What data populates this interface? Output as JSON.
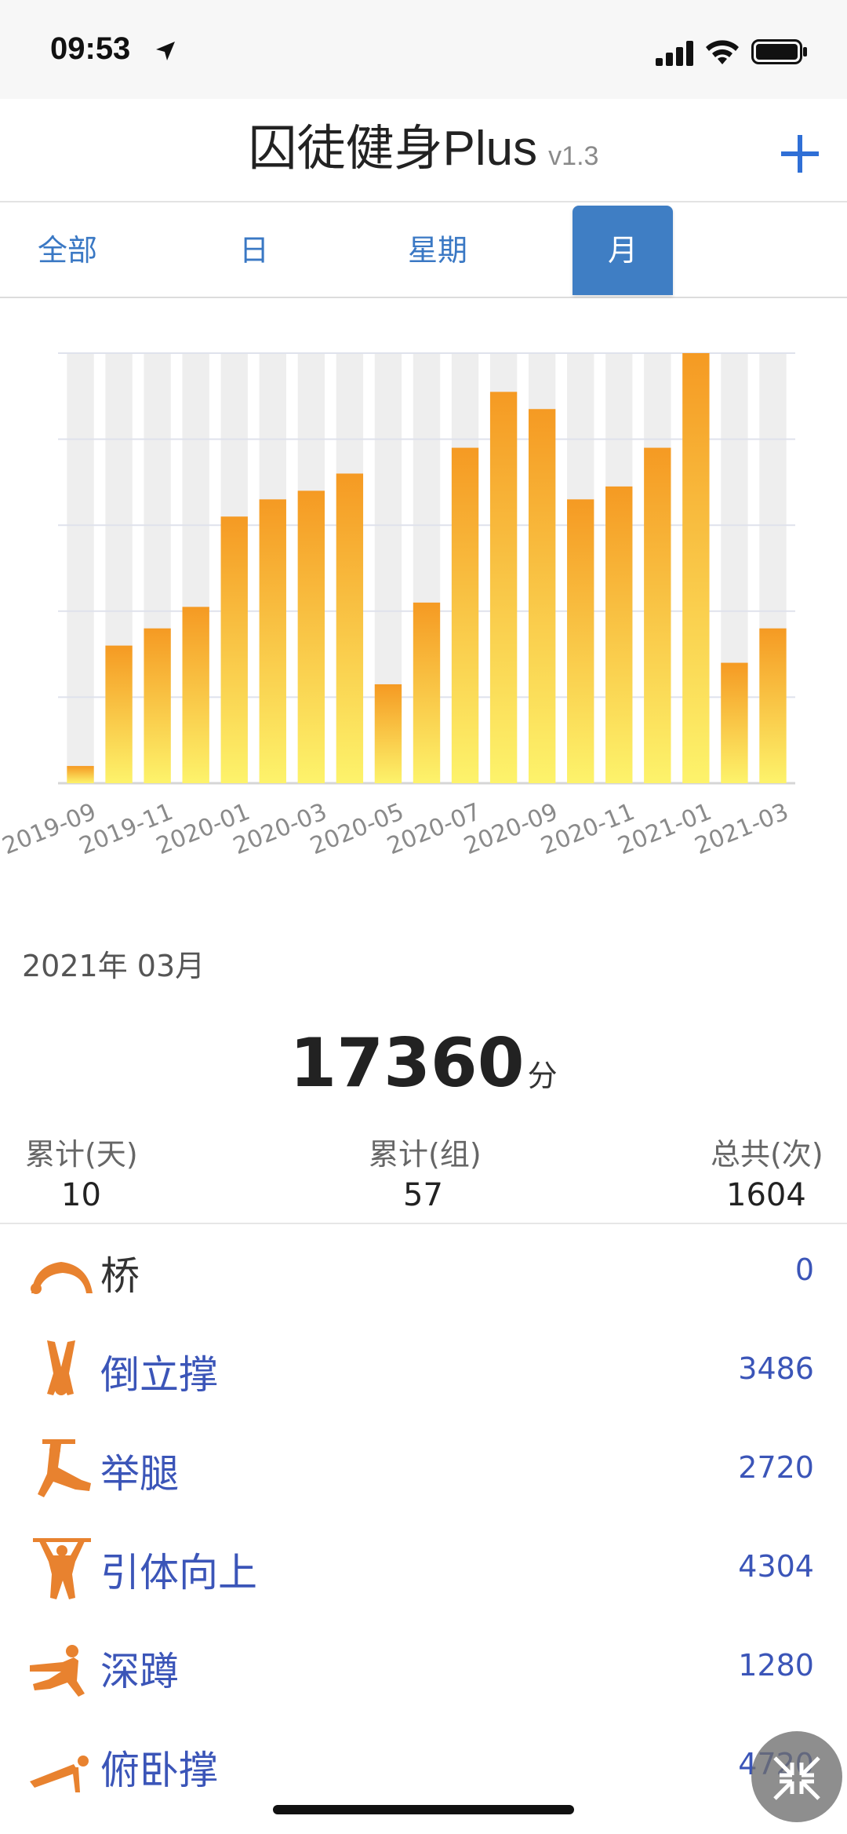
{
  "status_bar": {
    "time": "09:53"
  },
  "header": {
    "title": "囚徒健身Plus",
    "version": "v1.3"
  },
  "tabs": [
    {
      "label": "全部",
      "active": false
    },
    {
      "label": "日",
      "active": false
    },
    {
      "label": "星期",
      "active": false
    },
    {
      "label": "月",
      "active": true
    }
  ],
  "chart_data": {
    "type": "bar",
    "categories": [
      "2019-09",
      "2019-10",
      "2019-11",
      "2019-12",
      "2020-01",
      "2020-02",
      "2020-03",
      "2020-04",
      "2020-05",
      "2020-06",
      "2020-07",
      "2020-08",
      "2020-09",
      "2020-10",
      "2020-11",
      "2020-12",
      "2021-01",
      "2021-02",
      "2021-03"
    ],
    "tick_labels": [
      "2019-09",
      "2019-11",
      "2020-01",
      "2020-03",
      "2020-05",
      "2020-07",
      "2020-09",
      "2020-11",
      "2021-01",
      "2021-03"
    ],
    "values": [
      4,
      32,
      36,
      41,
      62,
      66,
      68,
      72,
      23,
      42,
      78,
      91,
      87,
      66,
      69,
      78,
      100,
      28,
      36
    ],
    "ylim": [
      0,
      100
    ],
    "grid": true,
    "colors": {
      "top": "#f59a23",
      "bottom": "#fdf36b",
      "track": "#eeeeee"
    }
  },
  "summary": {
    "period": "2021年 03月",
    "score": "17360",
    "score_unit": "分",
    "stats": [
      {
        "label": "累计(天)",
        "value": "10"
      },
      {
        "label": "累计(组)",
        "value": "57"
      },
      {
        "label": "总共(次)",
        "value": "1604"
      }
    ]
  },
  "exercises": [
    {
      "name": "桥",
      "count": "0",
      "icon": "bridge-icon"
    },
    {
      "name": "倒立撑",
      "count": "3486",
      "icon": "handstand-icon"
    },
    {
      "name": "举腿",
      "count": "2720",
      "icon": "leg-raise-icon"
    },
    {
      "name": "引体向上",
      "count": "4304",
      "icon": "pullup-icon"
    },
    {
      "name": "深蹲",
      "count": "1280",
      "icon": "squat-icon"
    },
    {
      "name": "俯卧撑",
      "count": "4720",
      "icon": "pushup-icon"
    }
  ]
}
